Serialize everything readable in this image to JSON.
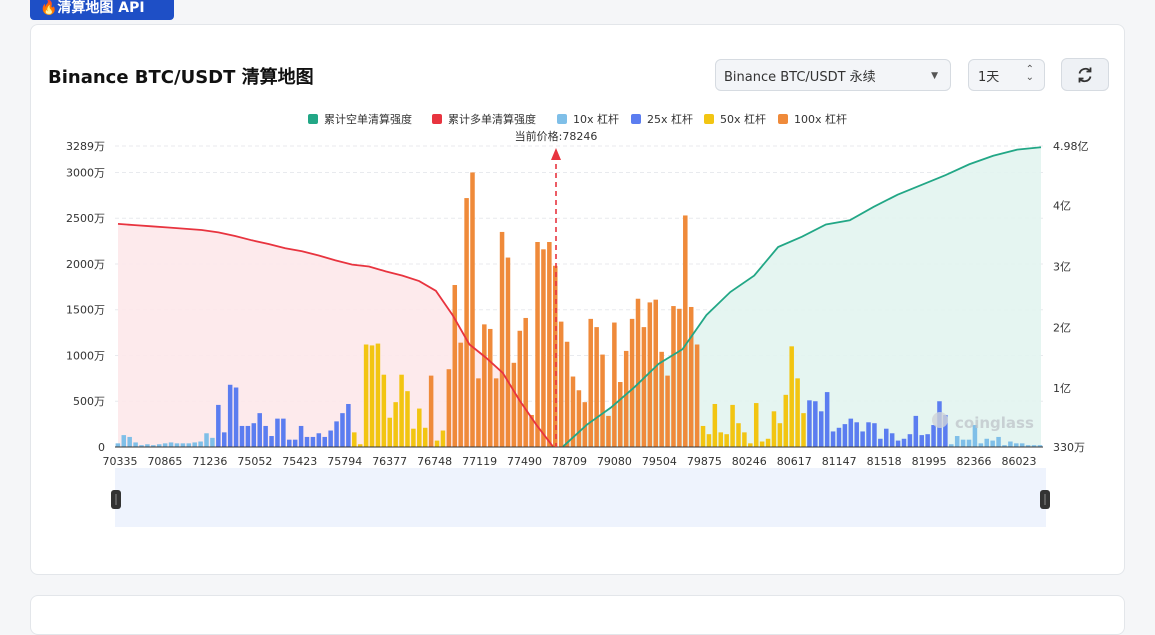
{
  "top_tag": "🔥清算地图 API",
  "title": "Binance BTC/USDT 清算地图",
  "exchange_select": "Binance BTC/USDT 永续",
  "period_select": "1天",
  "refresh_icon": "refresh-icon",
  "watermark": "coinglass",
  "colors": {
    "short_cum": "#22a786",
    "long_cum": "#e8343f",
    "lev10": "#7fbfe8",
    "lev25": "#5b7df0",
    "lev50": "#f2c512",
    "lev100": "#ef8a3a",
    "price_line": "#e8343f"
  },
  "chart_data": {
    "type": "bar",
    "legend": [
      {
        "name": "累计空单清算强度",
        "color": "#22a786"
      },
      {
        "name": "累计多单清算强度",
        "color": "#e8343f"
      },
      {
        "name": "10x 杠杆",
        "color": "#7fbfe8"
      },
      {
        "name": "25x 杠杆",
        "color": "#5b7df0"
      },
      {
        "name": "50x 杠杆",
        "color": "#f2c512"
      },
      {
        "name": "100x 杠杆",
        "color": "#ef8a3a"
      }
    ],
    "current_price_label": "当前价格:78246",
    "current_price": 78246,
    "x_tick_labels": [
      "70335",
      "70865",
      "71236",
      "75052",
      "75423",
      "75794",
      "76377",
      "76748",
      "77119",
      "77490",
      "78709",
      "79080",
      "79504",
      "79875",
      "80246",
      "80617",
      "81147",
      "81518",
      "81995",
      "82366",
      "86023"
    ],
    "y_left_ticks": [
      "0",
      "500万",
      "1000万",
      "1500万",
      "2000万",
      "2500万",
      "3000万",
      "3289万"
    ],
    "y_left_values": [
      0,
      500,
      1000,
      1500,
      2000,
      2500,
      3000,
      3289
    ],
    "y_right_ticks": [
      "330万",
      "1亿",
      "2亿",
      "3亿",
      "4亿",
      "4.98亿"
    ],
    "y_right_values": [
      330,
      10000,
      20000,
      30000,
      40000,
      49800
    ],
    "ylim_left": [
      0,
      3289
    ],
    "ylim_right": [
      330,
      49800
    ],
    "bars": [
      {
        "lev": "10x",
        "v": 40
      },
      {
        "lev": "10x",
        "v": 130
      },
      {
        "lev": "10x",
        "v": 110
      },
      {
        "lev": "10x",
        "v": 50
      },
      {
        "lev": "10x",
        "v": 20
      },
      {
        "lev": "10x",
        "v": 30
      },
      {
        "lev": "10x",
        "v": 20
      },
      {
        "lev": "10x",
        "v": 30
      },
      {
        "lev": "10x",
        "v": 40
      },
      {
        "lev": "10x",
        "v": 50
      },
      {
        "lev": "10x",
        "v": 40
      },
      {
        "lev": "10x",
        "v": 40
      },
      {
        "lev": "10x",
        "v": 40
      },
      {
        "lev": "10x",
        "v": 50
      },
      {
        "lev": "10x",
        "v": 60
      },
      {
        "lev": "10x",
        "v": 150
      },
      {
        "lev": "10x",
        "v": 100
      },
      {
        "lev": "25x",
        "v": 460
      },
      {
        "lev": "25x",
        "v": 160
      },
      {
        "lev": "25x",
        "v": 680
      },
      {
        "lev": "25x",
        "v": 650
      },
      {
        "lev": "25x",
        "v": 230
      },
      {
        "lev": "25x",
        "v": 230
      },
      {
        "lev": "25x",
        "v": 260
      },
      {
        "lev": "25x",
        "v": 370
      },
      {
        "lev": "25x",
        "v": 230
      },
      {
        "lev": "25x",
        "v": 120
      },
      {
        "lev": "25x",
        "v": 310
      },
      {
        "lev": "25x",
        "v": 310
      },
      {
        "lev": "25x",
        "v": 80
      },
      {
        "lev": "25x",
        "v": 80
      },
      {
        "lev": "25x",
        "v": 230
      },
      {
        "lev": "25x",
        "v": 110
      },
      {
        "lev": "25x",
        "v": 110
      },
      {
        "lev": "25x",
        "v": 150
      },
      {
        "lev": "25x",
        "v": 110
      },
      {
        "lev": "25x",
        "v": 180
      },
      {
        "lev": "25x",
        "v": 280
      },
      {
        "lev": "25x",
        "v": 370
      },
      {
        "lev": "25x",
        "v": 470
      },
      {
        "lev": "50x",
        "v": 160
      },
      {
        "lev": "50x",
        "v": 30
      },
      {
        "lev": "50x",
        "v": 1120
      },
      {
        "lev": "50x",
        "v": 1110
      },
      {
        "lev": "50x",
        "v": 1130
      },
      {
        "lev": "50x",
        "v": 790
      },
      {
        "lev": "50x",
        "v": 320
      },
      {
        "lev": "50x",
        "v": 490
      },
      {
        "lev": "50x",
        "v": 790
      },
      {
        "lev": "50x",
        "v": 610
      },
      {
        "lev": "50x",
        "v": 200
      },
      {
        "lev": "50x",
        "v": 420
      },
      {
        "lev": "50x",
        "v": 210
      },
      {
        "lev": "100x",
        "v": 780
      },
      {
        "lev": "50x",
        "v": 70
      },
      {
        "lev": "50x",
        "v": 180
      },
      {
        "lev": "100x",
        "v": 850
      },
      {
        "lev": "100x",
        "v": 1770
      },
      {
        "lev": "100x",
        "v": 1140
      },
      {
        "lev": "100x",
        "v": 2720
      },
      {
        "lev": "100x",
        "v": 3000
      },
      {
        "lev": "100x",
        "v": 750
      },
      {
        "lev": "100x",
        "v": 1340
      },
      {
        "lev": "100x",
        "v": 1290
      },
      {
        "lev": "100x",
        "v": 750
      },
      {
        "lev": "100x",
        "v": 2350
      },
      {
        "lev": "100x",
        "v": 2070
      },
      {
        "lev": "100x",
        "v": 920
      },
      {
        "lev": "100x",
        "v": 1270
      },
      {
        "lev": "100x",
        "v": 1410
      },
      {
        "lev": "100x",
        "v": 350
      },
      {
        "lev": "100x",
        "v": 2240
      },
      {
        "lev": "100x",
        "v": 2160
      },
      {
        "lev": "100x",
        "v": 2240
      },
      {
        "lev": "100x",
        "v": 1980
      },
      {
        "lev": "100x",
        "v": 1370
      },
      {
        "lev": "100x",
        "v": 1150
      },
      {
        "lev": "100x",
        "v": 770
      },
      {
        "lev": "100x",
        "v": 620
      },
      {
        "lev": "100x",
        "v": 490
      },
      {
        "lev": "100x",
        "v": 1400
      },
      {
        "lev": "100x",
        "v": 1310
      },
      {
        "lev": "100x",
        "v": 1010
      },
      {
        "lev": "100x",
        "v": 340
      },
      {
        "lev": "100x",
        "v": 1360
      },
      {
        "lev": "100x",
        "v": 710
      },
      {
        "lev": "100x",
        "v": 1050
      },
      {
        "lev": "100x",
        "v": 1400
      },
      {
        "lev": "100x",
        "v": 1620
      },
      {
        "lev": "100x",
        "v": 1310
      },
      {
        "lev": "100x",
        "v": 1580
      },
      {
        "lev": "100x",
        "v": 1610
      },
      {
        "lev": "100x",
        "v": 1040
      },
      {
        "lev": "100x",
        "v": 780
      },
      {
        "lev": "100x",
        "v": 1540
      },
      {
        "lev": "100x",
        "v": 1510
      },
      {
        "lev": "100x",
        "v": 2530
      },
      {
        "lev": "100x",
        "v": 1530
      },
      {
        "lev": "100x",
        "v": 1120
      },
      {
        "lev": "50x",
        "v": 230
      },
      {
        "lev": "50x",
        "v": 140
      },
      {
        "lev": "50x",
        "v": 470
      },
      {
        "lev": "50x",
        "v": 160
      },
      {
        "lev": "50x",
        "v": 140
      },
      {
        "lev": "50x",
        "v": 460
      },
      {
        "lev": "50x",
        "v": 260
      },
      {
        "lev": "50x",
        "v": 160
      },
      {
        "lev": "50x",
        "v": 40
      },
      {
        "lev": "50x",
        "v": 480
      },
      {
        "lev": "50x",
        "v": 60
      },
      {
        "lev": "50x",
        "v": 90
      },
      {
        "lev": "50x",
        "v": 390
      },
      {
        "lev": "50x",
        "v": 260
      },
      {
        "lev": "50x",
        "v": 570
      },
      {
        "lev": "50x",
        "v": 1100
      },
      {
        "lev": "50x",
        "v": 750
      },
      {
        "lev": "50x",
        "v": 370
      },
      {
        "lev": "25x",
        "v": 510
      },
      {
        "lev": "25x",
        "v": 500
      },
      {
        "lev": "25x",
        "v": 390
      },
      {
        "lev": "25x",
        "v": 600
      },
      {
        "lev": "25x",
        "v": 170
      },
      {
        "lev": "25x",
        "v": 210
      },
      {
        "lev": "25x",
        "v": 250
      },
      {
        "lev": "25x",
        "v": 310
      },
      {
        "lev": "25x",
        "v": 270
      },
      {
        "lev": "25x",
        "v": 170
      },
      {
        "lev": "25x",
        "v": 270
      },
      {
        "lev": "25x",
        "v": 260
      },
      {
        "lev": "25x",
        "v": 90
      },
      {
        "lev": "25x",
        "v": 200
      },
      {
        "lev": "25x",
        "v": 150
      },
      {
        "lev": "25x",
        "v": 70
      },
      {
        "lev": "25x",
        "v": 90
      },
      {
        "lev": "25x",
        "v": 140
      },
      {
        "lev": "25x",
        "v": 340
      },
      {
        "lev": "25x",
        "v": 130
      },
      {
        "lev": "25x",
        "v": 140
      },
      {
        "lev": "25x",
        "v": 240
      },
      {
        "lev": "25x",
        "v": 500
      },
      {
        "lev": "25x",
        "v": 350
      },
      {
        "lev": "10x",
        "v": 30
      },
      {
        "lev": "10x",
        "v": 120
      },
      {
        "lev": "10x",
        "v": 80
      },
      {
        "lev": "10x",
        "v": 80
      },
      {
        "lev": "10x",
        "v": 240
      },
      {
        "lev": "10x",
        "v": 40
      },
      {
        "lev": "10x",
        "v": 90
      },
      {
        "lev": "10x",
        "v": 70
      },
      {
        "lev": "10x",
        "v": 110
      },
      {
        "lev": "10x",
        "v": 20
      },
      {
        "lev": "10x",
        "v": 60
      },
      {
        "lev": "10x",
        "v": 40
      },
      {
        "lev": "10x",
        "v": 40
      },
      {
        "lev": "10x",
        "v": 20
      },
      {
        "lev": "10x",
        "v": 20
      },
      {
        "lev": "10x",
        "v": 20
      }
    ],
    "long_cum_series": [
      37000,
      36800,
      36600,
      36400,
      36200,
      36000,
      35600,
      35000,
      34300,
      33700,
      33000,
      32500,
      31800,
      31000,
      30300,
      30000,
      29200,
      28500,
      27600,
      26000,
      22000,
      17200,
      15000,
      12500,
      8000,
      4000,
      400
    ],
    "short_cum_series": [
      400,
      4000,
      6800,
      10200,
      14000,
      16400,
      22000,
      25800,
      28500,
      33200,
      34900,
      36900,
      37600,
      39800,
      41800,
      43400,
      45000,
      46800,
      48200,
      49200,
      49600
    ]
  }
}
